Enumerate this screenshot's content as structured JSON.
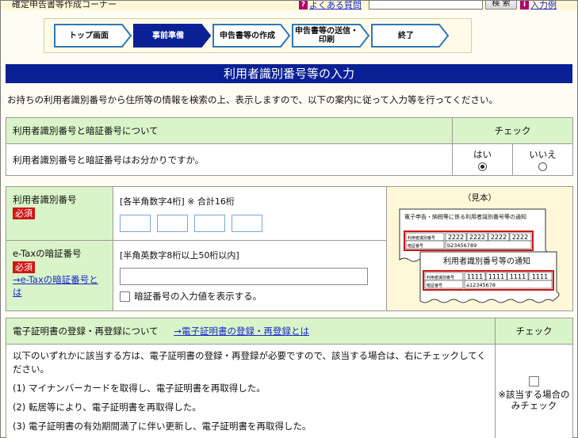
{
  "header": {
    "app_title": "確定申告書等作成コーナー",
    "faq_icon": "?",
    "faq_label": "よくある質問",
    "search_value": "",
    "search_button": "検 索",
    "input_example_icon": "i",
    "input_example_label": "入力例"
  },
  "steps": [
    {
      "label": "トップ画面",
      "state": "done"
    },
    {
      "label": "事前準備",
      "state": "current"
    },
    {
      "label": "申告書等の作成",
      "state": "todo"
    },
    {
      "label": "申告書等の送信・印刷",
      "state": "todo"
    },
    {
      "label": "終了",
      "state": "todo"
    }
  ],
  "page_title": "利用者識別番号等の入力",
  "intro": "お持ちの利用者識別番号から住所等の情報を検索の上、表示しますので、以下の案内に従って入力等を行ってください。",
  "section1": {
    "header": "利用者識別番号と暗証番号について",
    "check_header": "チェック",
    "question": "利用者識別番号と暗証番号はお分かりですか。",
    "yes": "はい",
    "no": "いいえ",
    "selected": "はい"
  },
  "section2": {
    "id_label": "利用者識別番号",
    "required": "必須",
    "id_hint": "[各半角数字4桁] ※ 合計16桁",
    "id_values": [
      "",
      "",
      "",
      ""
    ],
    "pw_label": "e-Taxの暗証番号",
    "pw_link": "→e-Taxの暗証番号とは",
    "pw_hint": "[半角英数字8桁以上50桁以内]",
    "pw_value": "",
    "show_pw_label": "暗証番号の入力値を表示する。",
    "sample": {
      "title": "（見本）",
      "doc1_title": "電子申告・納税等に係る利用者識別番号等の通知",
      "doc1_row1_label": "利用者識別番号",
      "doc1_row1_values": [
        "2222",
        "2222",
        "2222",
        "2222"
      ],
      "doc1_row2_label": "暗証番号",
      "doc1_row2_value": "b23456789",
      "doc2_title": "利用者識別番号等の通知",
      "doc2_row1_label": "利用者識別番号",
      "doc2_row1_values": [
        "1111",
        "1111",
        "1111",
        "1111"
      ],
      "doc2_row2_label": "暗証番号",
      "doc2_row2_value": "a12345678"
    }
  },
  "section3": {
    "header": "電子証明書の登録・再登録について",
    "link": "→電子証明書の登録・再登録とは",
    "check_header": "チェック",
    "lead": "以下のいずれかに該当する方は、電子証明書の登録・再登録が必要ですので、該当する場合は、右にチェックしてください。",
    "items": [
      "(1) マイナンバーカードを取得し、電子証明書を再取得した。",
      "(2) 転居等により、電子証明書を再取得した。",
      "(3) 電子証明書の有効期間満了に伴い更新し、電子証明書を再取得した。"
    ],
    "check_note": "※該当する場合のみチェック"
  },
  "colors": {
    "title_bar": "#0a2195",
    "header_green": "#d9f4c8",
    "required_red": "#d11515",
    "link_blue": "#1a28c8",
    "step_current": "#0a2195"
  }
}
